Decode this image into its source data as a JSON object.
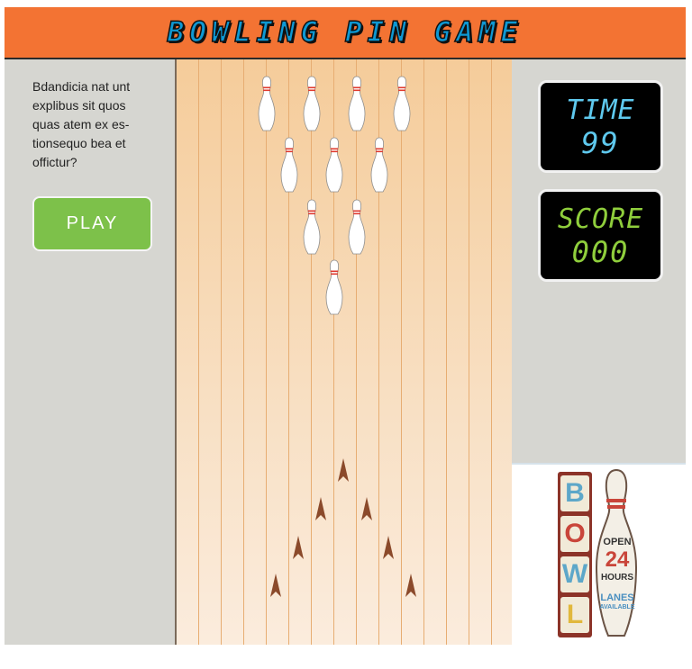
{
  "header": {
    "title": "BOWLING PIN GAME"
  },
  "sidebar": {
    "instructions": "Bdandicia nat unt explibus sit quos quas atem ex es-tionsequo bea et offictur?",
    "play_label": "PLAY"
  },
  "time": {
    "label": "TIME",
    "value": "99"
  },
  "score": {
    "label": "SCORE",
    "value": "000"
  },
  "sign": {
    "letters": [
      "B",
      "O",
      "W",
      "L"
    ],
    "open": "OPEN",
    "hours_number": "24",
    "hours": "HOURS",
    "lanes": "LANES",
    "available": "AVAILABLE"
  },
  "game": {
    "pins_standing": 10,
    "aim_arrows": 7
  },
  "colors": {
    "header_bg": "#f37333",
    "title": "#0e98d3",
    "play_button": "#7dc14a",
    "time_digits": "#5fc9ee",
    "score_digits": "#8fce3c",
    "panel_bg": "#d6d6d1",
    "pin_stripe": "#e03a2e",
    "arrow": "#8b4a2b"
  }
}
